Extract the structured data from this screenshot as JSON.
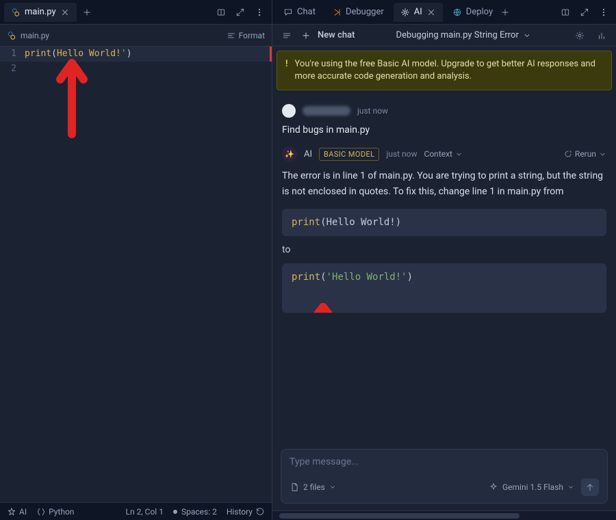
{
  "leftTabs": [
    {
      "label": "main.py",
      "icon": "python",
      "active": true
    }
  ],
  "fileHeader": {
    "name": "main.py",
    "formatLabel": "Format"
  },
  "code": {
    "lines": [
      {
        "n": 1,
        "segments": [
          {
            "t": "print",
            "c": "tok-fn"
          },
          {
            "t": "(",
            "c": "tok-punc"
          },
          {
            "t": "Hello World!",
            "c": "tok-err"
          },
          {
            "t": "'",
            "c": "tok-str"
          },
          {
            "t": ")",
            "c": "tok-punc"
          }
        ],
        "current": true
      },
      {
        "n": 2,
        "segments": [],
        "current": false
      }
    ]
  },
  "status": {
    "ai": "AI",
    "lang": "Python",
    "pos": "Ln 2, Col 1",
    "spaces": "Spaces: 2",
    "history": "History"
  },
  "rightTabs": [
    {
      "label": "Chat",
      "icon": "chat",
      "active": false
    },
    {
      "label": "Debugger",
      "icon": "debugger",
      "active": false
    },
    {
      "label": "AI",
      "icon": "ai",
      "active": true
    },
    {
      "label": "Deploy",
      "icon": "deploy",
      "active": false
    }
  ],
  "chat": {
    "newChatLabel": "New chat",
    "title": "Debugging main.py String Error",
    "banner": "You're using the free Basic AI model. Upgrade to get better AI responses and more accurate code generation and analysis.",
    "userTime": "just now",
    "userMessage": "Find bugs in main.py",
    "aiLabel": "AI",
    "aiModelBadge": "BASIC MODEL",
    "aiTime": "just now",
    "contextLabel": "Context",
    "rerunLabel": "Rerun",
    "aiText": "The error is in line 1 of main.py. You are trying to print a string, but the string is not enclosed in quotes. To fix this, change line 1 in main.py from",
    "codeBefore": {
      "fn": "print",
      "open": "(",
      "body": "Hello World!",
      "close": ")"
    },
    "toLabel": "to",
    "codeAfter": {
      "fn": "print",
      "open": "(",
      "str": "'Hello World!'",
      "close": ")"
    },
    "placeholder": "Type message...",
    "filesLabel": "2 files",
    "modelLabel": "Gemini 1.5 Flash"
  }
}
